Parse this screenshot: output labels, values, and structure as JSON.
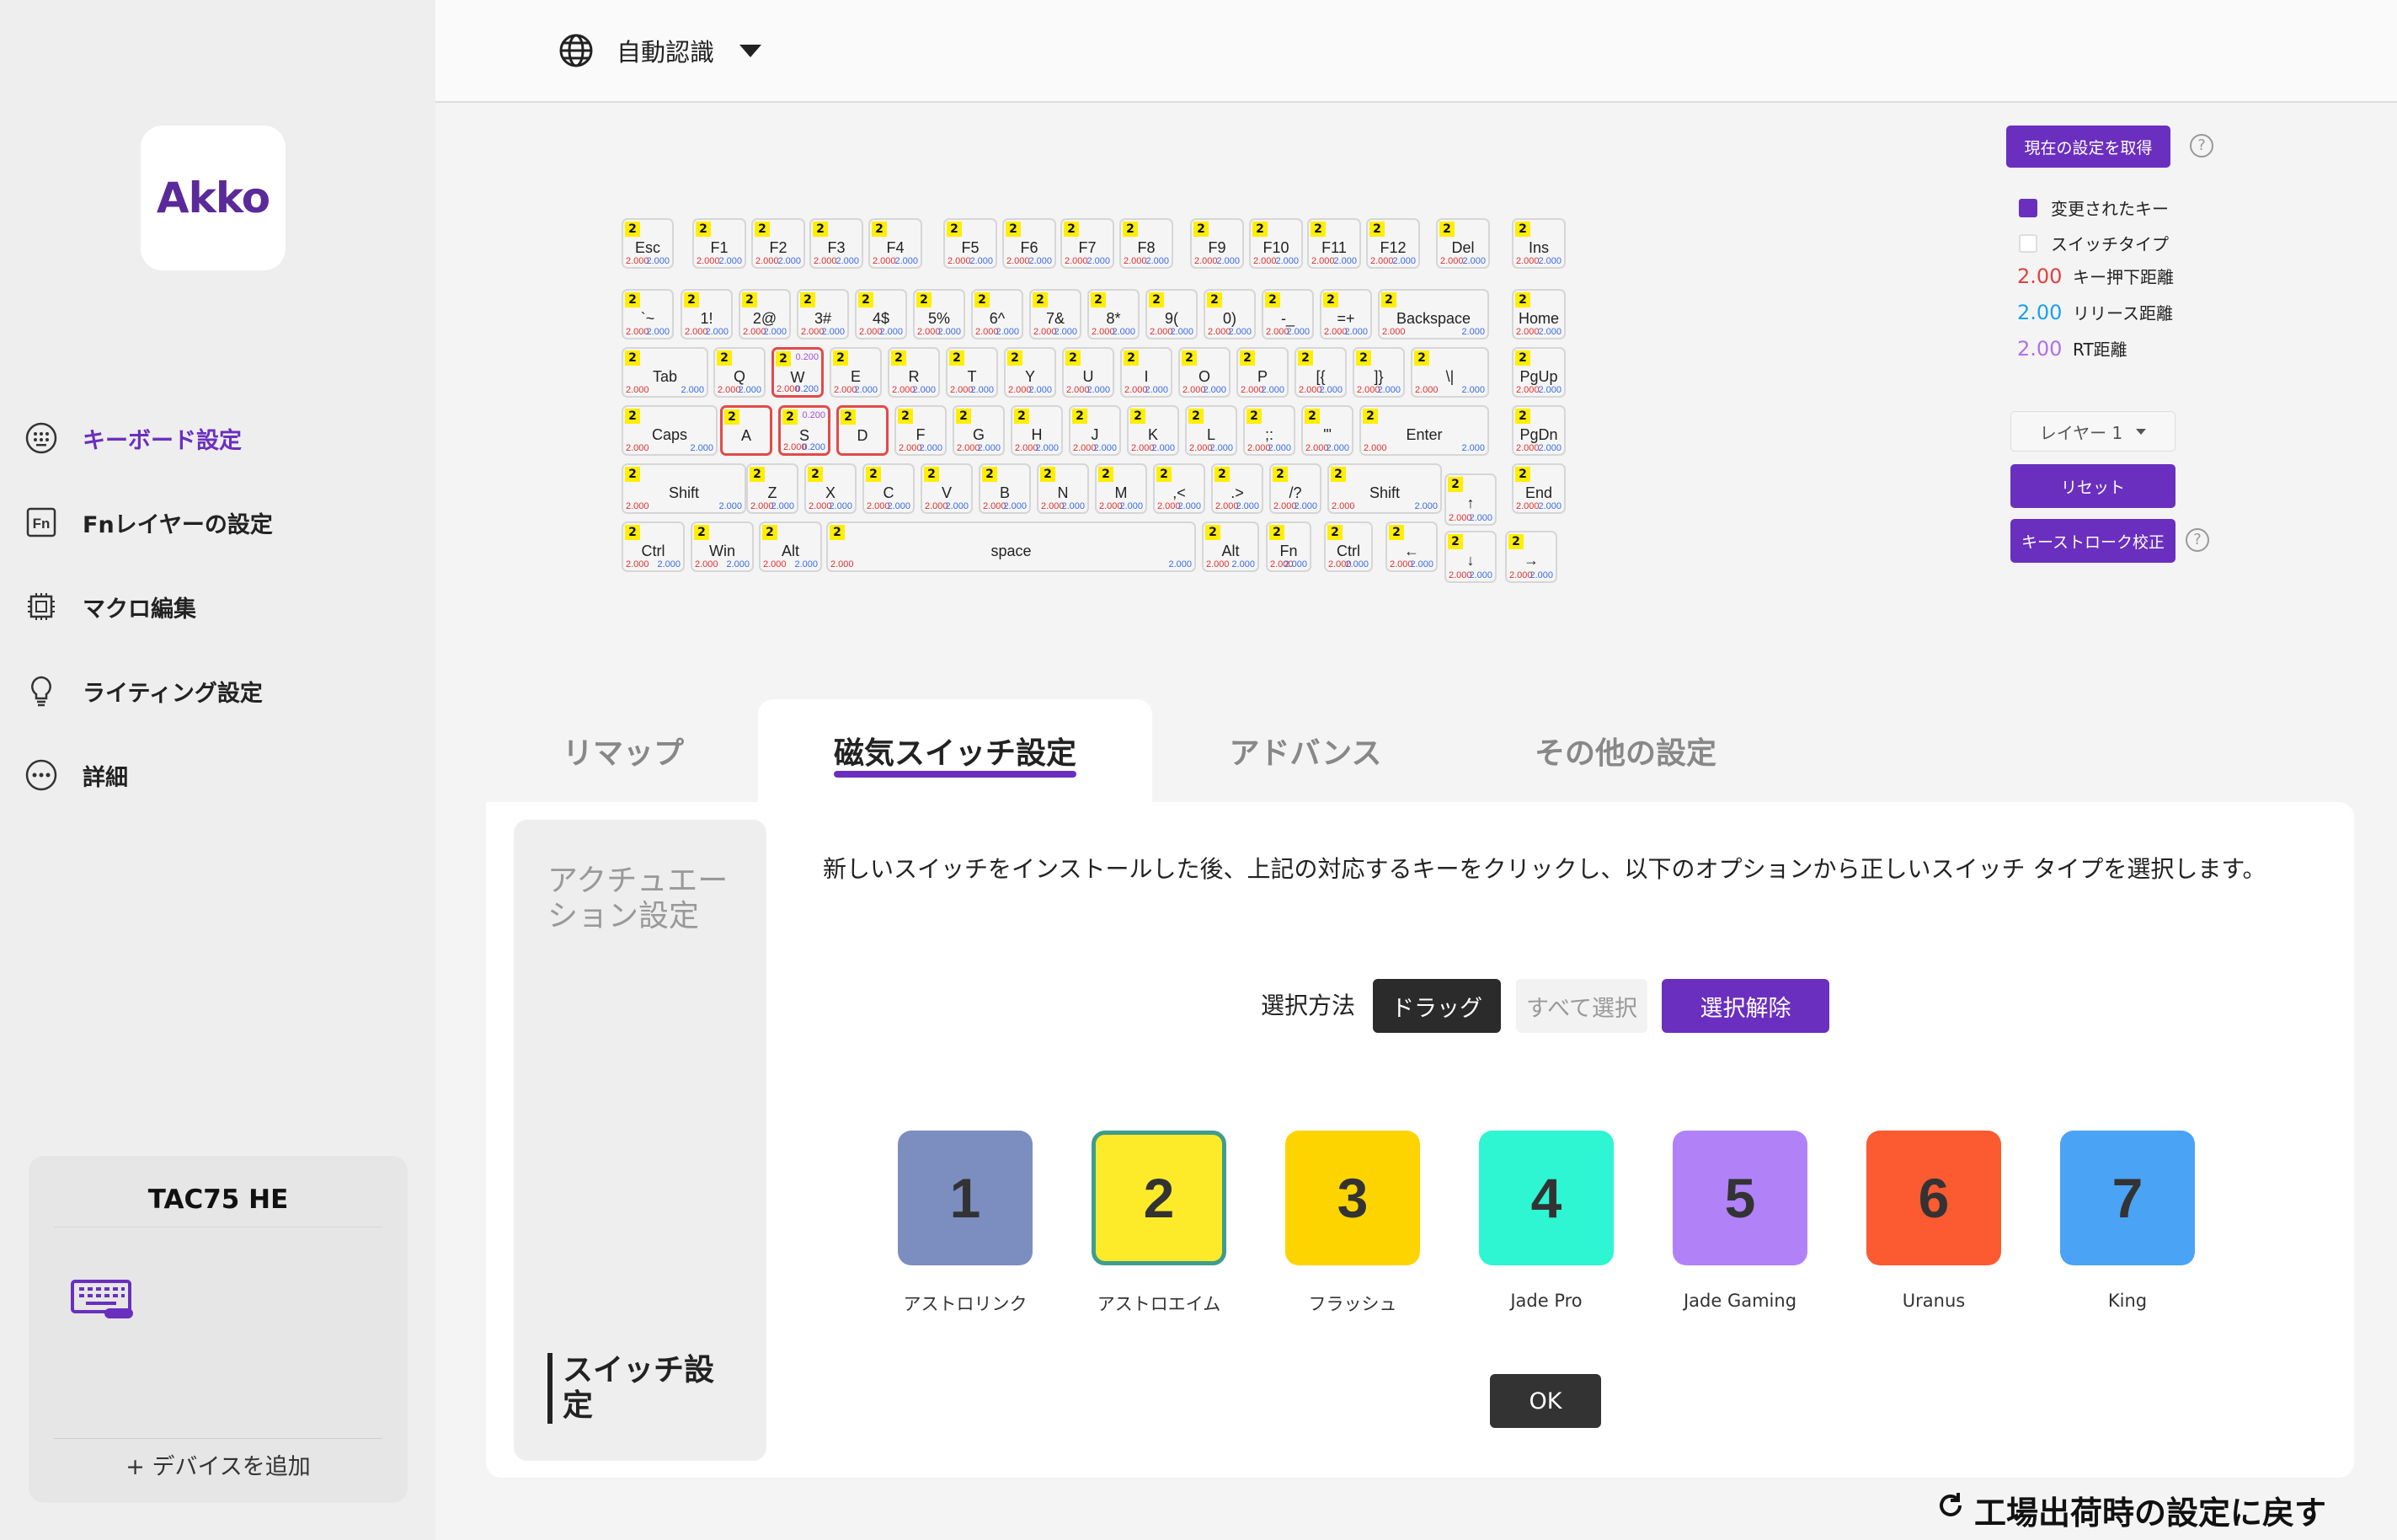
{
  "sidebar": {
    "logo": "Akko",
    "nav": [
      {
        "label": "キーボード設定"
      },
      {
        "label": "Fnレイヤーの設定"
      },
      {
        "label": "マクロ編集"
      },
      {
        "label": "ライティング設定"
      },
      {
        "label": "詳細"
      }
    ],
    "device": {
      "name": "TAC75 HE",
      "add_label": "+ デバイスを追加"
    }
  },
  "header": {
    "language": "自動認識"
  },
  "keyboard": {
    "keys": [
      {
        "label": "Esc",
        "badge": "2",
        "v1": "2.000",
        "v2": "2.000"
      },
      {
        "label": "F1",
        "badge": "2",
        "v1": "2.000",
        "v2": "2.000"
      },
      {
        "label": "F2",
        "badge": "2",
        "v1": "2.000",
        "v2": "2.000"
      },
      {
        "label": "F3",
        "badge": "2",
        "v1": "2.000",
        "v2": "2.000"
      },
      {
        "label": "F4",
        "badge": "2",
        "v1": "2.000",
        "v2": "2.000"
      },
      {
        "label": "F5",
        "badge": "2",
        "v1": "2.000",
        "v2": "2.000"
      },
      {
        "label": "F6",
        "badge": "2",
        "v1": "2.000",
        "v2": "2.000"
      },
      {
        "label": "F7",
        "badge": "2",
        "v1": "2.000",
        "v2": "2.000"
      },
      {
        "label": "F8",
        "badge": "2",
        "v1": "2.000",
        "v2": "2.000"
      },
      {
        "label": "F9",
        "badge": "2",
        "v1": "2.000",
        "v2": "2.000"
      },
      {
        "label": "F10",
        "badge": "2",
        "v1": "2.000",
        "v2": "2.000"
      },
      {
        "label": "F11",
        "badge": "2",
        "v1": "2.000",
        "v2": "2.000"
      },
      {
        "label": "F12",
        "badge": "2",
        "v1": "2.000",
        "v2": "2.000"
      },
      {
        "label": "Del",
        "badge": "2",
        "v1": "2.000",
        "v2": "2.000"
      },
      {
        "label": "Ins",
        "badge": "2",
        "v1": "2.000",
        "v2": "2.000"
      },
      {
        "label": "`~",
        "badge": "2",
        "v1": "2.000",
        "v2": "2.000"
      },
      {
        "label": "1!",
        "badge": "2",
        "v1": "2.000",
        "v2": "2.000"
      },
      {
        "label": "2@",
        "badge": "2",
        "v1": "2.000",
        "v2": "2.000"
      },
      {
        "label": "3#",
        "badge": "2",
        "v1": "2.000",
        "v2": "2.000"
      },
      {
        "label": "4$",
        "badge": "2",
        "v1": "2.000",
        "v2": "2.000"
      },
      {
        "label": "5%",
        "badge": "2",
        "v1": "2.000",
        "v2": "2.000"
      },
      {
        "label": "6^",
        "badge": "2",
        "v1": "2.000",
        "v2": "2.000"
      },
      {
        "label": "7&",
        "badge": "2",
        "v1": "2.000",
        "v2": "2.000"
      },
      {
        "label": "8*",
        "badge": "2",
        "v1": "2.000",
        "v2": "2.000"
      },
      {
        "label": "9(",
        "badge": "2",
        "v1": "2.000",
        "v2": "2.000"
      },
      {
        "label": "0)",
        "badge": "2",
        "v1": "2.000",
        "v2": "2.000"
      },
      {
        "label": "-_",
        "badge": "2",
        "v1": "2.000",
        "v2": "2.000"
      },
      {
        "label": "=+",
        "badge": "2",
        "v1": "2.000",
        "v2": "2.000"
      },
      {
        "label": "Backspace",
        "badge": "2",
        "v1": "2.000",
        "v2": "2.000"
      },
      {
        "label": "Home",
        "badge": "2",
        "v1": "2.000",
        "v2": "2.000"
      },
      {
        "label": "Tab",
        "badge": "2",
        "v1": "2.000",
        "v2": "2.000"
      },
      {
        "label": "Q",
        "badge": "2",
        "v1": "2.000",
        "v2": "2.000"
      },
      {
        "label": "W",
        "badge": "2",
        "v1": "2.000",
        "v2": "0.200",
        "v3": "0.200",
        "sel": true
      },
      {
        "label": "E",
        "badge": "2",
        "v1": "2.000",
        "v2": "2.000"
      },
      {
        "label": "R",
        "badge": "2",
        "v1": "2.000",
        "v2": "2.000"
      },
      {
        "label": "T",
        "badge": "2",
        "v1": "2.000",
        "v2": "2.000"
      },
      {
        "label": "Y",
        "badge": "2",
        "v1": "2.000",
        "v2": "2.000"
      },
      {
        "label": "U",
        "badge": "2",
        "v1": "2.000",
        "v2": "2.000"
      },
      {
        "label": "I",
        "badge": "2",
        "v1": "2.000",
        "v2": "2.000"
      },
      {
        "label": "O",
        "badge": "2",
        "v1": "2.000",
        "v2": "2.000"
      },
      {
        "label": "P",
        "badge": "2",
        "v1": "2.000",
        "v2": "2.000"
      },
      {
        "label": "[{",
        "badge": "2",
        "v1": "2.000",
        "v2": "2.000"
      },
      {
        "label": "]}",
        "badge": "2",
        "v1": "2.000",
        "v2": "2.000"
      },
      {
        "label": "\\|",
        "badge": "2",
        "v1": "2.000",
        "v2": "2.000"
      },
      {
        "label": "PgUp",
        "badge": "2",
        "v1": "2.000",
        "v2": "2.000"
      },
      {
        "label": "Caps",
        "badge": "2",
        "v1": "2.000",
        "v2": "2.000"
      },
      {
        "label": "A",
        "badge": "2",
        "v1": "",
        "v2": "",
        "sel": true
      },
      {
        "label": "S",
        "badge": "2",
        "v1": "2.000",
        "v2": "0.200",
        "v3": "0.200",
        "sel": true
      },
      {
        "label": "D",
        "badge": "2",
        "v1": "",
        "v2": "",
        "sel": true
      },
      {
        "label": "F",
        "badge": "2",
        "v1": "2.000",
        "v2": "2.000"
      },
      {
        "label": "G",
        "badge": "2",
        "v1": "2.000",
        "v2": "2.000"
      },
      {
        "label": "H",
        "badge": "2",
        "v1": "2.000",
        "v2": "2.000"
      },
      {
        "label": "J",
        "badge": "2",
        "v1": "2.000",
        "v2": "2.000"
      },
      {
        "label": "K",
        "badge": "2",
        "v1": "2.000",
        "v2": "2.000"
      },
      {
        "label": "L",
        "badge": "2",
        "v1": "2.000",
        "v2": "2.000"
      },
      {
        "label": ";:",
        "badge": "2",
        "v1": "2.000",
        "v2": "2.000"
      },
      {
        "label": "'\"",
        "badge": "2",
        "v1": "2.000",
        "v2": "2.000"
      },
      {
        "label": "Enter",
        "badge": "2",
        "v1": "2.000",
        "v2": "2.000"
      },
      {
        "label": "PgDn",
        "badge": "2",
        "v1": "2.000",
        "v2": "2.000"
      },
      {
        "label": "Shift",
        "badge": "2",
        "v1": "2.000",
        "v2": "2.000"
      },
      {
        "label": "Z",
        "badge": "2",
        "v1": "2.000",
        "v2": "2.000"
      },
      {
        "label": "X",
        "badge": "2",
        "v1": "2.000",
        "v2": "2.000"
      },
      {
        "label": "C",
        "badge": "2",
        "v1": "2.000",
        "v2": "2.000"
      },
      {
        "label": "V",
        "badge": "2",
        "v1": "2.000",
        "v2": "2.000"
      },
      {
        "label": "B",
        "badge": "2",
        "v1": "2.000",
        "v2": "2.000"
      },
      {
        "label": "N",
        "badge": "2",
        "v1": "2.000",
        "v2": "2.000"
      },
      {
        "label": "M",
        "badge": "2",
        "v1": "2.000",
        "v2": "2.000"
      },
      {
        "label": ",<",
        "badge": "2",
        "v1": "2.000",
        "v2": "2.000"
      },
      {
        "label": ".>",
        "badge": "2",
        "v1": "2.000",
        "v2": "2.000"
      },
      {
        "label": "/?",
        "badge": "2",
        "v1": "2.000",
        "v2": "2.000"
      },
      {
        "label": "Shift",
        "badge": "2",
        "v1": "2.000",
        "v2": "2.000"
      },
      {
        "label": "↑",
        "badge": "2",
        "v1": "2.000",
        "v2": "2.000"
      },
      {
        "label": "End",
        "badge": "2",
        "v1": "2.000",
        "v2": "2.000"
      },
      {
        "label": "Ctrl",
        "badge": "2",
        "v1": "2.000",
        "v2": "2.000"
      },
      {
        "label": "Win",
        "badge": "2",
        "v1": "2.000",
        "v2": "2.000"
      },
      {
        "label": "Alt",
        "badge": "2",
        "v1": "2.000",
        "v2": "2.000"
      },
      {
        "label": "space",
        "badge": "2",
        "v1": "2.000",
        "v2": "2.000"
      },
      {
        "label": "Alt",
        "badge": "2",
        "v1": "2.000",
        "v2": "2.000"
      },
      {
        "label": "Fn",
        "badge": "2",
        "v1": "2.000",
        "v2": "2.000"
      },
      {
        "label": "Ctrl",
        "badge": "2",
        "v1": "2.000",
        "v2": "2.000"
      },
      {
        "label": "←",
        "badge": "2",
        "v1": "2.000",
        "v2": "2.000"
      },
      {
        "label": "↓",
        "badge": "2",
        "v1": "2.000",
        "v2": "2.000"
      },
      {
        "label": "→",
        "badge": "2",
        "v1": "2.000",
        "v2": "2.000"
      }
    ]
  },
  "right_panel": {
    "get_settings_label": "現在の設定を取得",
    "legend": {
      "changed_label": "変更されたキー",
      "changed_color": "#6a2fbf",
      "switch_type_label": "スイッチタイプ",
      "press_value": "2.00",
      "press_label": "キー押下距離",
      "press_color": "#e53e3e",
      "release_value": "2.00",
      "release_label": "リリース距離",
      "release_color": "#1aa3e8",
      "rt_value": "2.00",
      "rt_label": "RT距離",
      "rt_color": "#b070e8"
    },
    "layer_value": "レイヤー 1",
    "reset_label": "リセット",
    "calibrate_label": "キーストローク校正",
    "help_glyph": "?"
  },
  "tabs": [
    {
      "label": "リマップ"
    },
    {
      "label": "磁気スイッチ設定"
    },
    {
      "label": "アドバンス"
    },
    {
      "label": "その他の設定"
    }
  ],
  "panel": {
    "subnav": {
      "actuation_label": "アクチュエーション設定",
      "switch_label": "スイッチ設定"
    },
    "description": "新しいスイッチをインストールした後、上記の対応するキーをクリックし、以下のオプションから正しいスイッチ タイプを選択します。",
    "selection": {
      "label": "選択方法",
      "drag_label": "ドラッグ",
      "select_all_label": "すべて選択",
      "deselect_label": "選択解除"
    },
    "switches": [
      {
        "number": "1",
        "name": "アストロリンク",
        "color": "#7b8ebf"
      },
      {
        "number": "2",
        "name": "アストロエイム",
        "color": "#fdeb2a",
        "selected": true
      },
      {
        "number": "3",
        "name": "フラッシュ",
        "color": "#fdd400"
      },
      {
        "number": "4",
        "name": "Jade Pro",
        "color": "#2ef5d2"
      },
      {
        "number": "5",
        "name": "Jade Gaming",
        "color": "#b182f7"
      },
      {
        "number": "6",
        "name": "Uranus",
        "color": "#fc5a30"
      },
      {
        "number": "7",
        "name": "King",
        "color": "#4aa3f5"
      }
    ],
    "ok_label": "OK"
  },
  "factory_reset_label": "工場出荷時の設定に戻す"
}
